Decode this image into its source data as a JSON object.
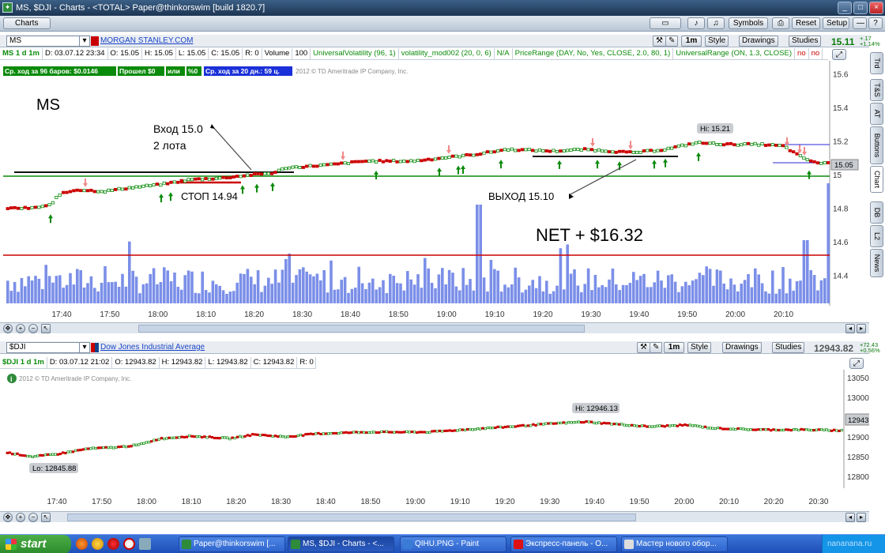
{
  "window": {
    "title": "MS, $DJI - Charts - <TOTAL> Paper@thinkorswim [build 1820.7]",
    "buttons": [
      "Symbols",
      "Reset",
      "Setup"
    ]
  },
  "toolbar": {
    "charts_tab": "Charts"
  },
  "top": {
    "symbol": "MS",
    "company": "MORGAN STANLEY.COM",
    "interval": "1m",
    "style": "Style",
    "drawings": "Drawings",
    "studies": "Studies",
    "last_price": "15.11",
    "change_abs": "+.17",
    "change_pct": "+1.14%",
    "info": [
      "MS 1 d 1m",
      "D: 03.07.12 23:34",
      "O: 15.05",
      "H: 15.05",
      "L: 15.05",
      "C: 15.05",
      "R: 0",
      "Volume",
      "100",
      "UniversalVolatility (96, 1)",
      "volatility_mod002 (20, 0, 6)",
      "N/A",
      "PriceRange (DAY, No, Yes, CLOSE, 2.0, 80, 1)",
      "UniversalRange (ON, 1.3, CLOSE)",
      "no",
      "no"
    ],
    "labels": [
      "Ср. ход за 96 баров: $0.0146",
      "Прошел $0",
      "или",
      "%0",
      "Ср. ход за 20 дн.: 59 ц."
    ],
    "copyright": "2012 © TD Ameritrade IP Company, Inc.",
    "annotations": {
      "symbol": "MS",
      "entry": "Вход 15.0",
      "lots": "2 лота",
      "stop": "СТОП 14.94",
      "exit": "ВЫХОД 15.10",
      "net": "NET + $16.32",
      "hi": "Hi: 15.21",
      "last": "15.05"
    },
    "yticks": [
      "15.6",
      "15.4",
      "15.2",
      "15",
      "14.8",
      "14.6",
      "14.4"
    ],
    "xticks": [
      "17:40",
      "17:50",
      "18:00",
      "18:10",
      "18:20",
      "18:30",
      "18:40",
      "18:50",
      "19:00",
      "19:10",
      "19:20",
      "19:30",
      "19:40",
      "19:50",
      "20:00",
      "20:10"
    ]
  },
  "side_tabs": [
    "Trd",
    "T&S",
    "AT",
    "Buttons",
    "Chart",
    "DB",
    "L2",
    "News"
  ],
  "bottom": {
    "symbol": "$DJI",
    "company": "Dow Jones Industrial Average",
    "interval": "1m",
    "style": "Style",
    "drawings": "Drawings",
    "studies": "Studies",
    "last_price": "12943.82",
    "change_abs": "+72.43",
    "change_pct": "+0.56%",
    "info": [
      "$DJI 1 d 1m",
      "D: 03.07.12 21:02",
      "O: 12943.82",
      "H: 12943.82",
      "L: 12943.82",
      "C: 12943.82",
      "R: 0"
    ],
    "copyright": "2012 © TD Ameritrade IP Company, Inc.",
    "hi": "Hi: 12946.13",
    "lo": "Lo: 12845.88",
    "last": "12943.82",
    "yticks": [
      "13050",
      "13000",
      "12950",
      "12900",
      "12850",
      "12800"
    ],
    "xticks": [
      "17:40",
      "17:50",
      "18:00",
      "18:10",
      "18:20",
      "18:30",
      "18:40",
      "18:50",
      "19:00",
      "19:10",
      "19:20",
      "19:30",
      "19:40",
      "19:50",
      "20:00",
      "20:10",
      "20:20",
      "20:30"
    ]
  },
  "taskbar": {
    "start": "start",
    "tasks": [
      "Paper@thinkorswim [...",
      "MS, $DJI - Charts - <...",
      "QIHU.PNG - Paint",
      "Экспресс-панель - O...",
      "Мастер нового обор..."
    ],
    "watermark": "nananana.ru"
  },
  "colors": {
    "up": "#0a8a0a",
    "down": "#cc0000",
    "volume": "#7b8fe8",
    "stop": "#cc0000",
    "support": "#000000"
  }
}
